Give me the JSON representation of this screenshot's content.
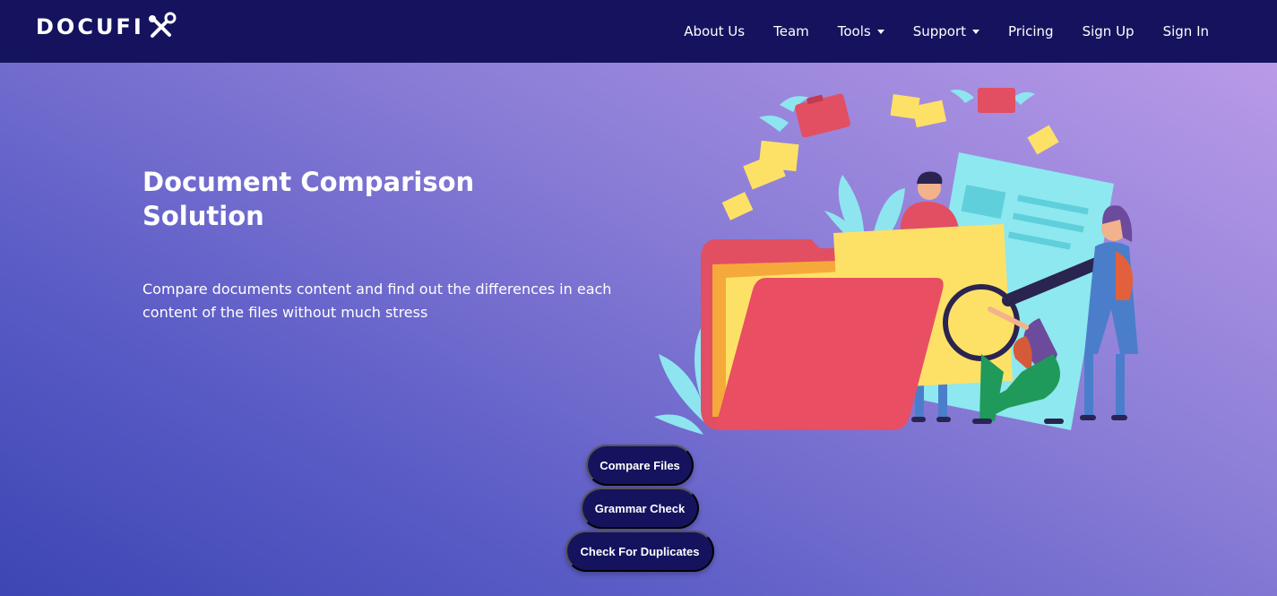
{
  "brand": {
    "name": "DOCUFI",
    "icon": "tools-icon"
  },
  "nav": {
    "items": [
      {
        "label": "About Us",
        "dropdown": false
      },
      {
        "label": "Team",
        "dropdown": false
      },
      {
        "label": "Tools",
        "dropdown": true
      },
      {
        "label": "Support",
        "dropdown": true
      },
      {
        "label": "Pricing",
        "dropdown": false
      },
      {
        "label": "Sign Up",
        "dropdown": false
      },
      {
        "label": "Sign In",
        "dropdown": false
      }
    ]
  },
  "hero": {
    "title": "Document Comparison Solution",
    "description": "Compare documents content and find out the differences in each content of the files without much stress",
    "buttons": {
      "compare": "Compare Files",
      "grammar": "Grammar Check",
      "duplicates": "Check For Duplicates"
    }
  },
  "colors": {
    "navbar": "#15135e",
    "button": "#15135e",
    "gradient_start": "#3c46b4",
    "gradient_end": "#b99ae8"
  }
}
